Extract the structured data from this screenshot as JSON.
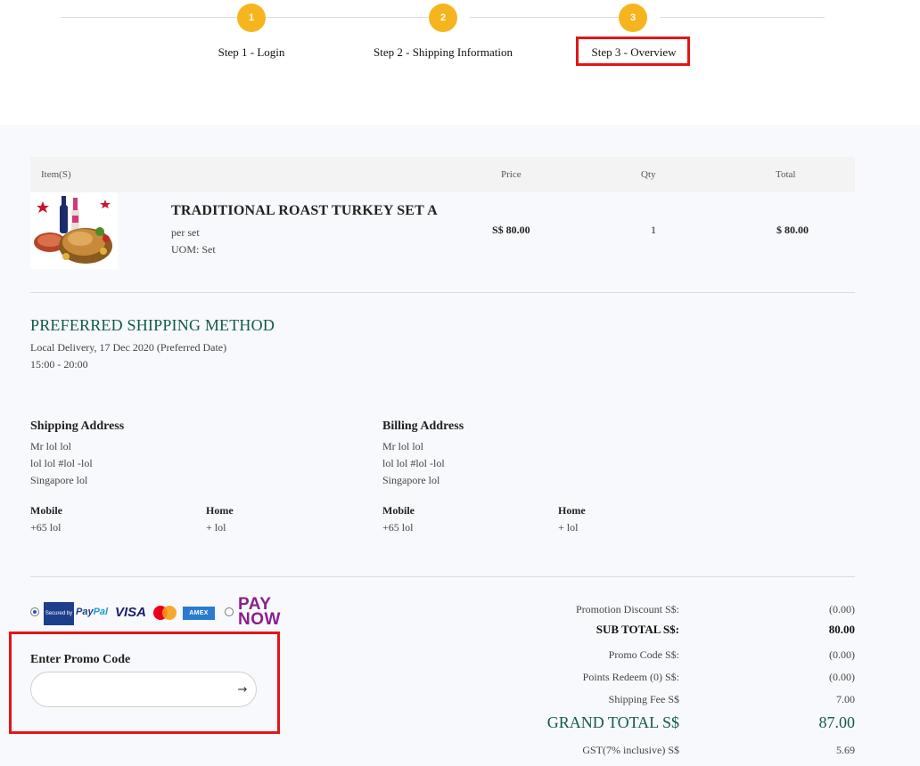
{
  "steps": [
    {
      "number": "1",
      "label": "Step 1 - Login"
    },
    {
      "number": "2",
      "label": "Step 2 - Shipping Information"
    },
    {
      "number": "3",
      "label": "Step 3 - Overview"
    }
  ],
  "table": {
    "headers": {
      "item": "Item(S)",
      "price": "Price",
      "qty": "Qty",
      "total": "Total"
    }
  },
  "product": {
    "name": "TRADITIONAL ROAST TURKEY SET A",
    "per": "per set",
    "uom": "UOM: Set",
    "price": "S$ 80.00",
    "qty": "1",
    "total": "$ 80.00"
  },
  "shipping_method": {
    "title": "PREFERRED SHIPPING METHOD",
    "line1": "Local Delivery, 17 Dec 2020 (Preferred Date)",
    "line2": "15:00 - 20:00"
  },
  "shipping_address": {
    "title": "Shipping Address",
    "name": "Mr lol lol",
    "line1": "lol lol #lol -lol",
    "line2": "Singapore lol",
    "mobile_label": "Mobile",
    "mobile": "+65 lol",
    "home_label": "Home",
    "home": "+ lol"
  },
  "billing_address": {
    "title": "Billing Address",
    "name": "Mr lol lol",
    "line1": "lol lol #lol -lol",
    "line2": "Singapore lol",
    "mobile_label": "Mobile",
    "mobile": "+65 lol",
    "home_label": "Home",
    "home": "+ lol"
  },
  "payment": {
    "paypal_secured": "Secured by",
    "paypal_pay": "Pay",
    "paypal_pal": "Pal",
    "visa": "VISA",
    "amex": "AMEX",
    "paynow_line1": "PAY",
    "paynow_line2": "NOW",
    "selected": "paypal"
  },
  "promo": {
    "label": "Enter Promo Code",
    "value": "",
    "placeholder": ""
  },
  "totals": {
    "promotion_discount_label": "Promotion Discount S$:",
    "promotion_discount": "(0.00)",
    "subtotal_label": "SUB TOTAL S$:",
    "subtotal": "80.00",
    "promo_code_label": "Promo Code S$:",
    "promo_code": "(0.00)",
    "points_label": "Points Redeem (0) S$:",
    "points": "(0.00)",
    "shipping_label": "Shipping Fee S$",
    "shipping": "7.00",
    "grand_label": "GRAND TOTAL S$",
    "grand": "87.00",
    "gst_label": "GST(7% inclusive) S$",
    "gst": "5.69"
  },
  "colors": {
    "step_accent": "#f6b51e",
    "highlight_red": "#e3151a",
    "heading_green": "#0f5c48"
  }
}
